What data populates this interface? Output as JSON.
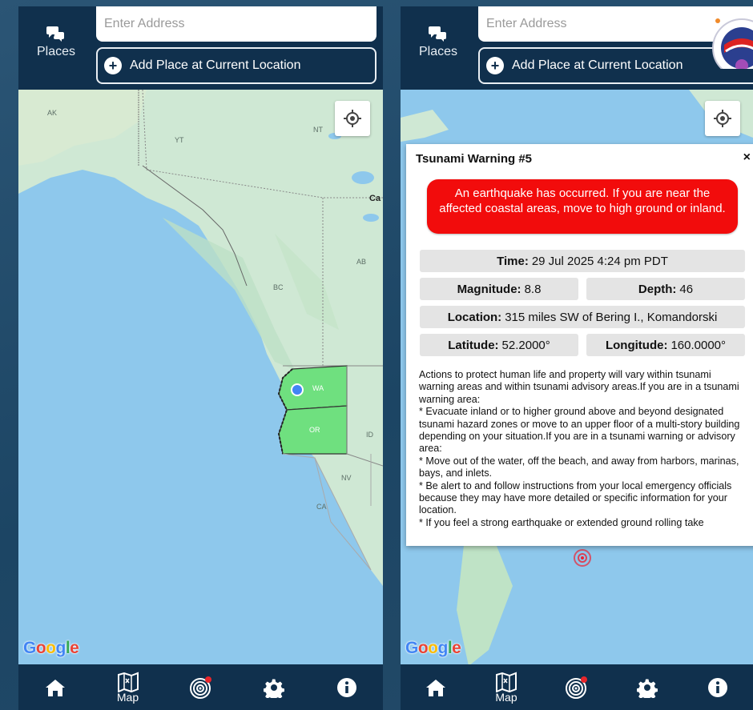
{
  "header": {
    "places_label": "Places",
    "address_placeholder": "Enter Address",
    "add_place_label": "Add Place at Current Location"
  },
  "map_left": {
    "labels": {
      "ak": "AK",
      "yt": "YT",
      "nt": "NT",
      "ca": "Ca",
      "bc": "BC",
      "ab": "AB",
      "wa": "WA",
      "or": "OR",
      "id": "ID",
      "nv": "NV",
      "ca_state": "CA"
    },
    "colors": {
      "water": "#8ec8ec",
      "land": "#cfe8d4",
      "highlight": "#6fe07f",
      "location_dot": "#4285f4"
    }
  },
  "google_logo": "Google",
  "nav": {
    "home_icon": "home-icon",
    "map_label": "Map",
    "alerts_icon": "target-alert-icon",
    "settings_icon": "gear-icon",
    "info_icon": "info-icon",
    "badge_color": "#e8262b",
    "bar_color": "#10304d"
  },
  "popup": {
    "title": "Tsunami Warning #5",
    "close": "×",
    "alert_text": "An earthquake has occurred. If you are near the affected coastal areas, move to high ground or inland.",
    "alert_color": "#f20c0c",
    "time_label": "Time:",
    "time_value": "29 Jul 2025 4:24 pm PDT",
    "magnitude_label": "Magnitude:",
    "magnitude_value": "8.8",
    "depth_label": "Depth:",
    "depth_value": "46",
    "location_label": "Location:",
    "location_value": "315 miles SW of Bering I., Komandorski",
    "latitude_label": "Latitude:",
    "latitude_value": "52.2000°",
    "longitude_label": "Longitude:",
    "longitude_value": "160.0000°",
    "body": [
      "Actions to protect human life and property will vary within tsunami warning areas and within tsunami advisory areas.If you are in a tsunami warning area:",
      "* Evacuate inland or to higher ground above and beyond designated tsunami hazard zones or move to an upper floor of a multi-story building depending on your situation.If you are in a tsunami warning or advisory area:",
      "* Move out of the water, off the beach, and away from harbors, marinas, bays, and inlets.",
      "* Be alert to and follow instructions from your local emergency officials because they may have more detailed or specific information for your location.",
      "* If you feel a strong earthquake or extended ground rolling take"
    ]
  }
}
